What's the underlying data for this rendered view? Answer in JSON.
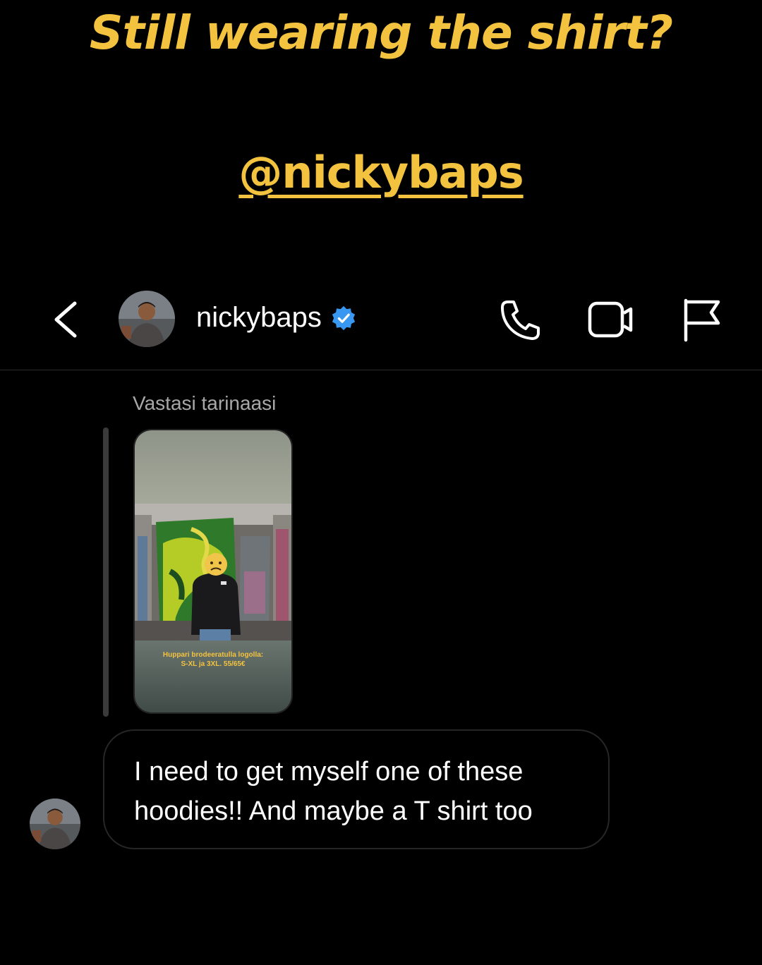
{
  "story_overlay": {
    "title": "Still wearing the shirt?",
    "mention": "@nickybaps"
  },
  "header": {
    "username": "nickybaps",
    "verified": true,
    "icons": {
      "back": "chevron-left-icon",
      "verified": "verified-badge-icon",
      "phone": "phone-icon",
      "video": "video-camera-icon",
      "flag": "flag-icon"
    }
  },
  "thread": {
    "reply_label": "Vastasi tarinaasi",
    "story_preview": {
      "caption_line1": "Huppari brodeeratulla logolla:",
      "caption_line2": "S-XL ja 3XL. 55/65€"
    },
    "message": {
      "line1": "I need to get myself one of these",
      "line2": "hoodies!! And maybe a T shirt too"
    }
  },
  "colors": {
    "background": "#000000",
    "accent_yellow": "#f3c33f",
    "verified_blue": "#3897f0",
    "muted_text": "#a8a8a8",
    "bubble_border": "#262626"
  }
}
